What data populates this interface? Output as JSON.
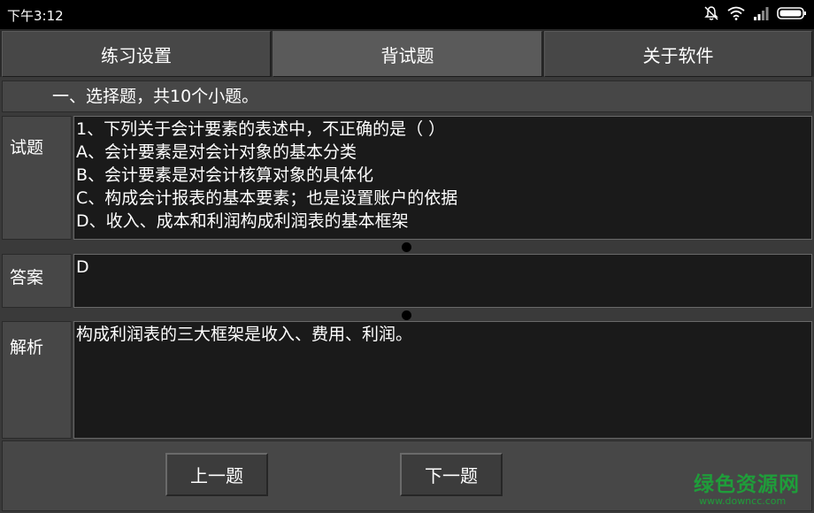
{
  "status_bar": {
    "time": "下午3:12",
    "icons": [
      "mute-icon",
      "wifi-icon",
      "signal-icon",
      "battery-icon"
    ]
  },
  "tabs": [
    {
      "label": "练习设置",
      "active": false
    },
    {
      "label": "背试题",
      "active": true
    },
    {
      "label": "关于软件",
      "active": false
    }
  ],
  "section_header": "一、选择题，共10个小题。",
  "question": {
    "label": "试题",
    "lines": [
      "1、下列关于会计要素的表述中，不正确的是（ ）",
      "A、会计要素是对会计对象的基本分类",
      "B、会计要素是对会计核算对象的具体化",
      "C、构成会计报表的基本要素；也是设置账户的依据",
      "D、收入、成本和利润构成利润表的基本框架"
    ]
  },
  "answer": {
    "label": "答案",
    "value": "D"
  },
  "analysis": {
    "label": "解析",
    "value": "构成利润表的三大框架是收入、费用、利润。"
  },
  "navigation": {
    "prev_label": "上一题",
    "next_label": "下一题"
  },
  "watermark": {
    "main": "绿色资源网",
    "sub": "www.downcc.com"
  },
  "colors": {
    "panel": "#474747",
    "text_box": "#1a1a1a",
    "watermark": "#1f9d3a"
  }
}
